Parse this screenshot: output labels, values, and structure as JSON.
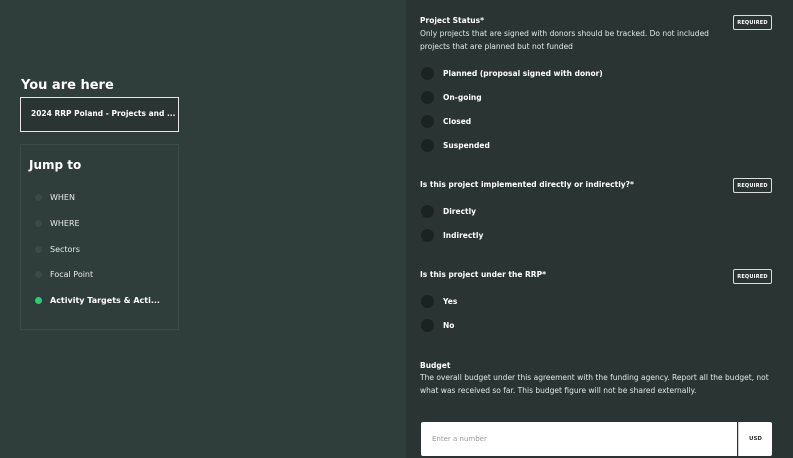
{
  "sidebar": {
    "you_are_here_title": "You are here",
    "you_are_here_value": "2024 RRP Poland - Projects and ...",
    "jump_to_title": "Jump to",
    "jump_items": [
      {
        "label": "WHEN",
        "active": false
      },
      {
        "label": "WHERE",
        "active": false
      },
      {
        "label": "Sectors",
        "active": false
      },
      {
        "label": "Focal Point",
        "active": false
      },
      {
        "label": "Activity Targets & Acti...",
        "active": true
      }
    ],
    "active_color": "#2ecc71"
  },
  "form": {
    "required_badge": "REQUIRED",
    "project_status": {
      "label": "Project Status*",
      "description": "Only projects that are signed with donors should be tracked. Do not included projects that are planned but not funded",
      "options": [
        "Planned (proposal signed with donor)",
        "On-going",
        "Closed",
        "Suspended"
      ]
    },
    "implementation": {
      "label": "Is this project implemented directly or indirectly?*",
      "options": [
        "Directly",
        "Indirectly"
      ]
    },
    "rrp": {
      "label": "Is this project under the RRP*",
      "options": [
        "Yes",
        "No"
      ]
    },
    "budget": {
      "label": "Budget",
      "description": "The overall budget under this agreement with the funding agency. Report all the budget, not what was received so far. This budget figure will not be shared externally.",
      "placeholder": "Enter a number",
      "value": "",
      "unit": "USD"
    }
  }
}
